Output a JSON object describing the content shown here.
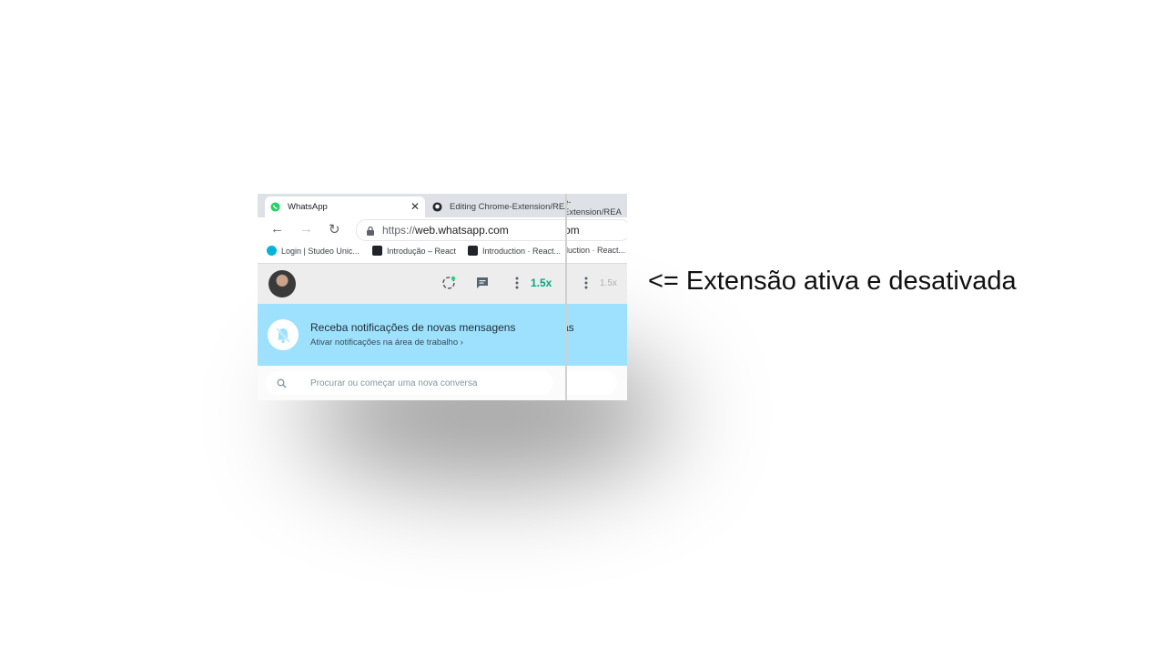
{
  "browser": {
    "active_tab_title": "WhatsApp",
    "inactive_tab_title": "Editing Chrome-Extension/REA",
    "inactive_tab_title_back": "e-Extension/REA",
    "url_scheme": "https://",
    "url_host": "web.whatsapp.com",
    "url_back_tail": "om",
    "bookmarks": [
      "Login | Studeo Unic...",
      "Introdução – React",
      "Introduction · React..."
    ],
    "bookmark_back": "duction · React..."
  },
  "whatsapp": {
    "speed_active": "1.5x",
    "speed_inactive": "1.5x",
    "banner_title": "Receba notificações de novas mensagens",
    "banner_subtitle": "Ativar notificações na área de trabalho",
    "banner_back_tail": "as",
    "search_placeholder": "Procurar ou começar uma nova conversa"
  },
  "caption": "<= Extensão ativa e desativada",
  "colors": {
    "whatsapp_green": "#25d366",
    "speed_green": "#00a884",
    "banner_blue": "#9de1fe"
  },
  "icons": [
    "whatsapp-favicon",
    "github-favicon",
    "back-arrow-icon",
    "forward-arrow-icon",
    "reload-icon",
    "lock-icon",
    "studeo-icon",
    "react-icon",
    "status-icon",
    "new-chat-icon",
    "menu-dots-icon",
    "bell-off-icon",
    "chevron-right-icon",
    "search-icon"
  ]
}
